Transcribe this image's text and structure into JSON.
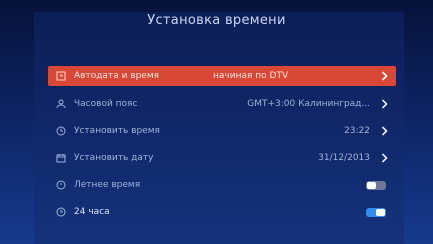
{
  "title": "Установка времени",
  "rows": [
    {
      "label": "Автодата и время",
      "value": "начиная по DTV",
      "icon": "clock-sync-icon"
    },
    {
      "label": "Часовой пояс",
      "value": "GMT+3:00 Калининград...",
      "icon": "person-icon"
    },
    {
      "label": "Установить время",
      "value": "23:22",
      "icon": "clock-icon"
    },
    {
      "label": "Установить дату",
      "value": "31/12/2013",
      "icon": "calendar-icon"
    },
    {
      "label": "Летнее время",
      "icon": "sun-clock-icon",
      "toggle": "off"
    },
    {
      "label": "24 часа",
      "icon": "clock-24-icon",
      "toggle": "on"
    }
  ],
  "colors": {
    "accent": "#d94836",
    "toggle_on": "#2f8df0",
    "toggle_off": "#6e7894"
  }
}
